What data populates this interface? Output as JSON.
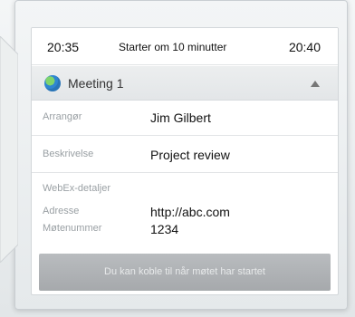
{
  "header": {
    "time_start": "20:35",
    "starts_in": "Starter om 10 minutter",
    "time_end": "20:40"
  },
  "meeting": {
    "title": "Meeting 1"
  },
  "details": {
    "organizer_label": "Arrangør",
    "organizer_value": "Jim Gilbert",
    "description_label": "Beskrivelse",
    "description_value": "Project review"
  },
  "webex": {
    "title": "WebEx-detaljer",
    "address_label": "Adresse",
    "address_value": "http://abc.com",
    "number_label": "Møtenummer",
    "number_value": "1234"
  },
  "footer": {
    "button_label": "Du kan koble til når møtet har startet"
  },
  "colors": {
    "button_bg": "#b0b3b6",
    "label_color": "#9aa0a4",
    "icon_color": "#2f86d1"
  }
}
